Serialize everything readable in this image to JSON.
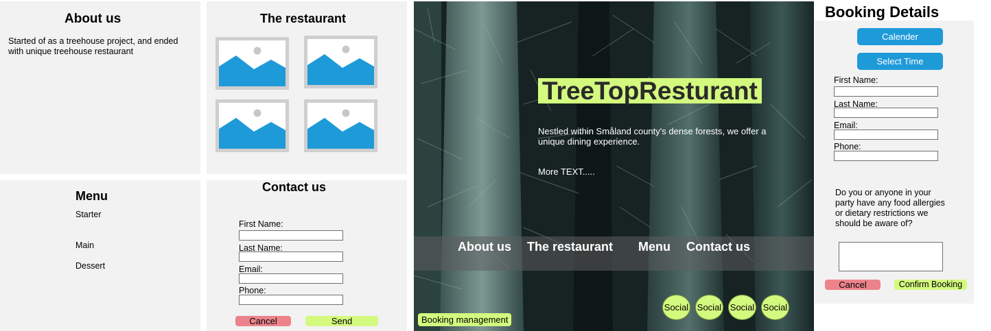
{
  "about": {
    "title": "About us",
    "text": "Started of as a treehouse project, and ended with unique treehouse restaurant"
  },
  "restaurant": {
    "title": "The restaurant",
    "images": [
      "image-placeholder-icon",
      "image-placeholder-icon",
      "image-placeholder-icon",
      "image-placeholder-icon"
    ]
  },
  "menu": {
    "title": "Menu",
    "items": [
      "Starter",
      "Main",
      "Dessert"
    ]
  },
  "contact": {
    "title": "Contact us",
    "fields": [
      "First Name:",
      "Last Name:",
      "Email:",
      "Phone:"
    ],
    "cancel": "Cancel",
    "send": "Send"
  },
  "hero": {
    "title": "TreeTopResturant",
    "description": "Nestled within Småland county's dense forests, we offer a unique dining experience.",
    "more": "More TEXT.....",
    "nav": [
      "About us",
      "The restaurant",
      "Menu",
      "Contact us"
    ],
    "social": [
      "Social",
      "Social",
      "Social",
      "Social"
    ],
    "booking_management": "Booking management"
  },
  "booking": {
    "title": "Booking Details",
    "calendar": "Calender",
    "select_time": "Select Time",
    "fields": [
      "First Name:",
      "Last Name:",
      "Email:",
      "Phone:"
    ],
    "allergy_question": "Do you or anyone in your party have any food allergies or  dietary restrictions we should be aware of?",
    "cancel": "Cancel",
    "confirm": "Confirm Booking"
  },
  "colors": {
    "panel": "#f2f2f2",
    "accent_green": "#d3f97f",
    "cancel_red": "#ec838b",
    "button_blue": "#1f9ad9"
  }
}
